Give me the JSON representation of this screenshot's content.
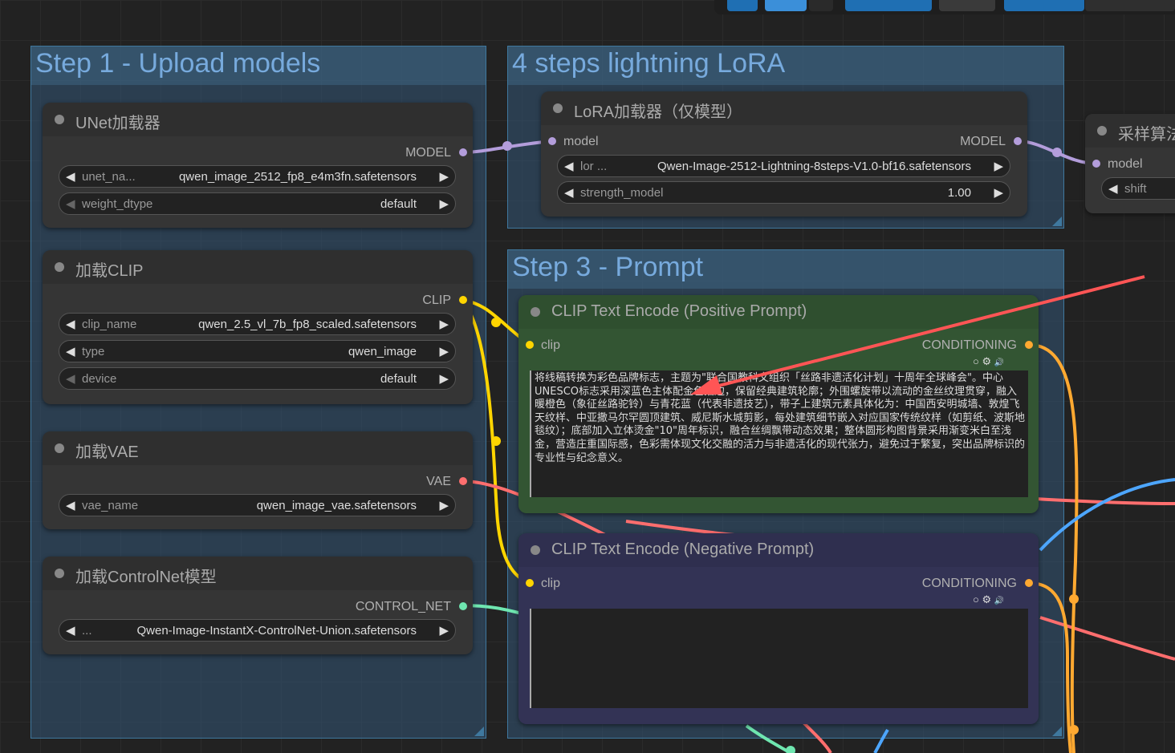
{
  "colors": {
    "model": "#b39ddb",
    "clip": "#ffd500",
    "vae": "#ff6e6e",
    "control_net": "#6fe6b0",
    "conditioning": "#ffa931",
    "positive_node": "#335533",
    "negative_node": "#333355"
  },
  "groups": [
    {
      "title": "Step 1 - Upload models"
    },
    {
      "title": "4 steps lightning LoRA"
    },
    {
      "title": "Step 3 - Prompt"
    }
  ],
  "nodes": {
    "unet": {
      "title": "UNet加载器",
      "output": "MODEL",
      "widgets": [
        {
          "label": "unet_na...",
          "value": "qwen_image_2512_fp8_e4m3fn.safetensors"
        },
        {
          "label": "weight_dtype",
          "value": "default"
        }
      ]
    },
    "clip_loader": {
      "title": "加载CLIP",
      "output": "CLIP",
      "widgets": [
        {
          "label": "clip_name",
          "value": "qwen_2.5_vl_7b_fp8_scaled.safetensors"
        },
        {
          "label": "type",
          "value": "qwen_image"
        },
        {
          "label": "device",
          "value": "default"
        }
      ]
    },
    "vae_loader": {
      "title": "加载VAE",
      "output": "VAE",
      "widgets": [
        {
          "label": "vae_name",
          "value": "qwen_image_vae.safetensors"
        }
      ]
    },
    "controlnet_loader": {
      "title": "加载ControlNet模型",
      "output": "CONTROL_NET",
      "widgets": [
        {
          "label": "...",
          "value": "Qwen-Image-InstantX-ControlNet-Union.safetensors"
        }
      ]
    },
    "lora": {
      "title": "LoRA加载器（仅模型）",
      "input": "model",
      "output": "MODEL",
      "widgets": [
        {
          "label": "lor ...",
          "value": "Qwen-Image-2512-Lightning-8steps-V1.0-bf16.safetensors"
        },
        {
          "label": "strength_model",
          "value": "1.00"
        }
      ]
    },
    "sampling": {
      "title": "采样算法",
      "input": "model",
      "widget_label": "shift"
    },
    "positive": {
      "title": "CLIP Text Encode (Positive Prompt)",
      "input": "clip",
      "output": "CONDITIONING",
      "text": "将线稿转换为彩色品牌标志，主题为\"联合国教科文组织「丝路非遗活化计划」十周年全球峰会\"。中心UNESCO标志采用深蓝色主体配金色描边，保留经典建筑轮廓；外围螺旋带以流动的金丝纹理贯穿，融入暖橙色（象征丝路驼铃）与青花蓝（代表非遗技艺），带子上建筑元素具体化为：中国西安明城墙、敦煌飞天纹样、中亚撒马尔罕圆顶建筑、威尼斯水城剪影，每处建筑细节嵌入对应国家传统纹样（如剪纸、波斯地毯纹）；底部加入立体烫金\"10\"周年标识，融合丝绸飘带动态效果；整体圆形构图背景采用渐变米白至浅金，营造庄重国际感，色彩需体现文化交融的活力与非遗活化的现代张力，避免过于繁复，突出品牌标识的专业性与纪念意义。"
    },
    "negative": {
      "title": "CLIP Text Encode (Negative Prompt)",
      "input": "clip",
      "output": "CONDITIONING",
      "text": ""
    }
  }
}
